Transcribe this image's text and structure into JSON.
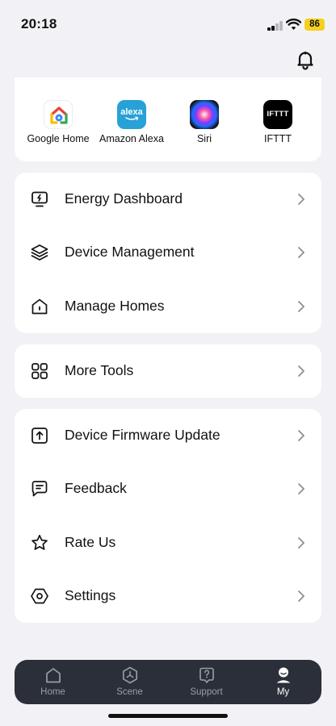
{
  "status_bar": {
    "time": "20:18",
    "battery": "86"
  },
  "integrations": [
    {
      "name": "Google Home",
      "icon": "google-home-logo"
    },
    {
      "name": "Amazon Alexa",
      "icon": "alexa-logo",
      "logo_text": "alexa"
    },
    {
      "name": "Siri",
      "icon": "siri-logo"
    },
    {
      "name": "IFTTT",
      "icon": "ifttt-logo",
      "logo_text": "IFTTT"
    }
  ],
  "menu_group_1": [
    {
      "label": "Energy Dashboard",
      "icon": "energy-dashboard-icon"
    },
    {
      "label": "Device Management",
      "icon": "layers-icon"
    },
    {
      "label": "Manage Homes",
      "icon": "home-icon"
    }
  ],
  "menu_group_2": [
    {
      "label": "More Tools",
      "icon": "grid-icon"
    }
  ],
  "menu_group_3": [
    {
      "label": "Device Firmware Update",
      "icon": "firmware-upload-icon"
    },
    {
      "label": "Feedback",
      "icon": "feedback-icon"
    },
    {
      "label": "Rate Us",
      "icon": "star-icon"
    },
    {
      "label": "Settings",
      "icon": "settings-hex-icon"
    }
  ],
  "tabbar": {
    "tabs": [
      {
        "label": "Home",
        "icon": "home-tab-icon",
        "active": false
      },
      {
        "label": "Scene",
        "icon": "scene-tab-icon",
        "active": false
      },
      {
        "label": "Support",
        "icon": "support-tab-icon",
        "active": false
      },
      {
        "label": "My",
        "icon": "profile-tab-icon",
        "active": true
      }
    ]
  },
  "colors": {
    "background": "#f2f2f6",
    "card": "#ffffff",
    "tabbar": "#2b2f3a",
    "battery": "#f5d020"
  }
}
